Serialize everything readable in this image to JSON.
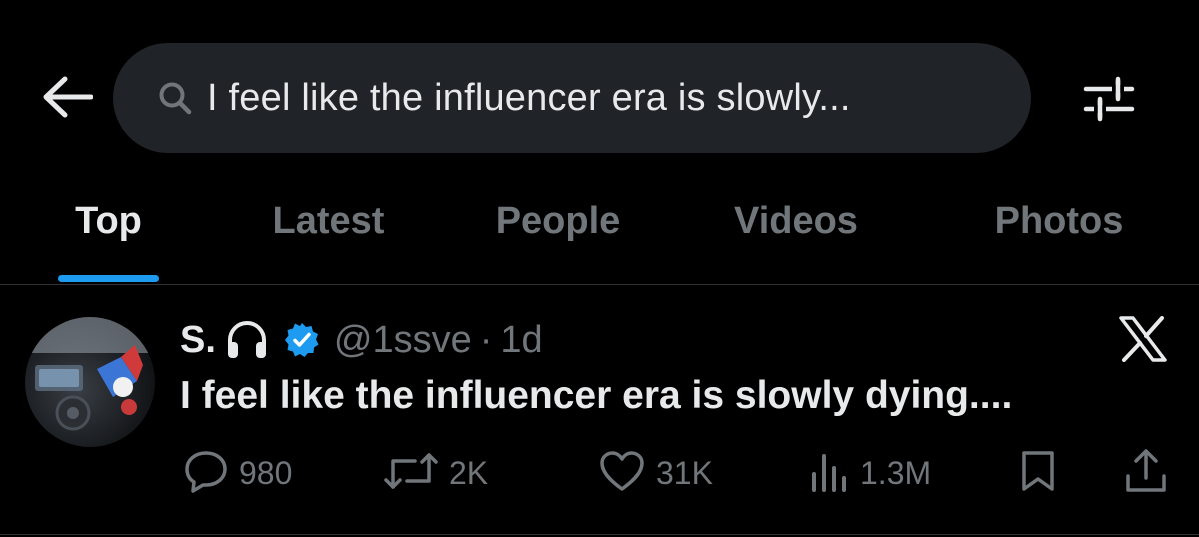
{
  "search": {
    "query": "I feel like the influencer era is slowly..."
  },
  "icons": {
    "back": "arrow-left-icon",
    "search": "search-icon",
    "filter": "sliders-icon",
    "verified": "verified-badge-icon",
    "headphones": "headphones-icon",
    "x_logo": "x-logo-icon",
    "reply": "reply-icon",
    "repost": "repost-icon",
    "like": "heart-icon",
    "views": "views-icon",
    "bookmark": "bookmark-icon",
    "share": "share-icon"
  },
  "tabs": [
    {
      "label": "Top",
      "active": true
    },
    {
      "label": "Latest",
      "active": false
    },
    {
      "label": "People",
      "active": false
    },
    {
      "label": "Videos",
      "active": false
    },
    {
      "label": "Photos",
      "active": false
    }
  ],
  "tweet": {
    "display_name": "S.",
    "handle": "@1ssve",
    "separator": "·",
    "time": "1d",
    "text": "I feel like the influencer era is slowly dying....",
    "replies": "980",
    "reposts": "2K",
    "likes": "31K",
    "views": "1.3M"
  },
  "colors": {
    "background": "#000000",
    "text_primary": "#e7e9ea",
    "text_secondary": "#71767b",
    "accent": "#1d9bf0",
    "search_bg": "#202327",
    "divider": "#2f3336"
  }
}
